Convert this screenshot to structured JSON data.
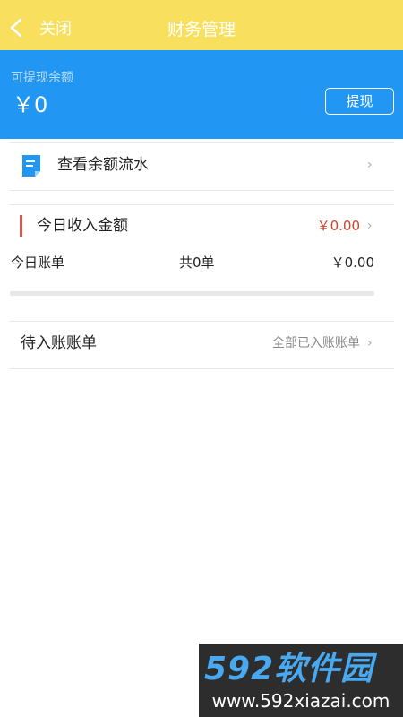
{
  "header": {
    "back_icon": "chevron-left-icon",
    "close_label": "关闭",
    "title": "财务管理"
  },
  "balance": {
    "label": "可提现余额",
    "amount": "￥0",
    "withdraw_label": "提现"
  },
  "balance_flow": {
    "icon": "document-icon",
    "label": "查看余额流水"
  },
  "today": {
    "income_label": "今日收入金额",
    "income_amount": "￥0.00",
    "bill_label": "今日账单",
    "bill_count": "共0单",
    "bill_amount": "￥0.00"
  },
  "pending": {
    "label": "待入账账单",
    "status": "全部已入账账单"
  },
  "watermark": {
    "brand": "592软件园",
    "url": "www.592xiazai.com"
  },
  "colors": {
    "header_bg": "#f9df5e",
    "balance_bg": "#2196f3",
    "income_accent": "#d9534f",
    "income_amount": "#d0442c"
  }
}
